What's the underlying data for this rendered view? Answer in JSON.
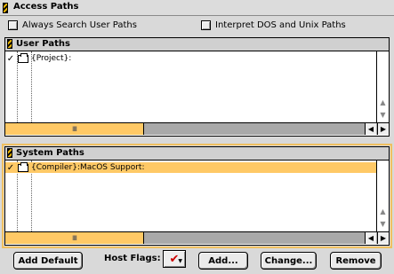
{
  "window": {
    "title": "Access Paths"
  },
  "options": {
    "always_search_label": "Always Search User Paths",
    "always_search_checked": false,
    "interpret_label": "Interpret DOS and Unix Paths",
    "interpret_checked": false
  },
  "user_paths": {
    "header": "User Paths",
    "rows": [
      {
        "check": "✓",
        "path": "{Project}:",
        "selected": false
      }
    ],
    "scroll_thumb": "lllll"
  },
  "system_paths": {
    "header": "System Paths",
    "rows": [
      {
        "check": "✓",
        "path": "{Compiler}:MacOS Support:",
        "selected": true
      }
    ],
    "scroll_thumb": "lllll"
  },
  "buttons": {
    "add_default": "Add Default",
    "host_flags_label": "Host Flags:",
    "add": "Add...",
    "change": "Change...",
    "remove": "Remove"
  },
  "colors": {
    "selection": "#ffc966",
    "accent_outline": "#f0c060",
    "flag_mark": "#cc0000"
  },
  "icons": {
    "row_check": "checkmark-icon",
    "row_folder": "folder-icon",
    "flag": "red-checkmark-icon"
  }
}
